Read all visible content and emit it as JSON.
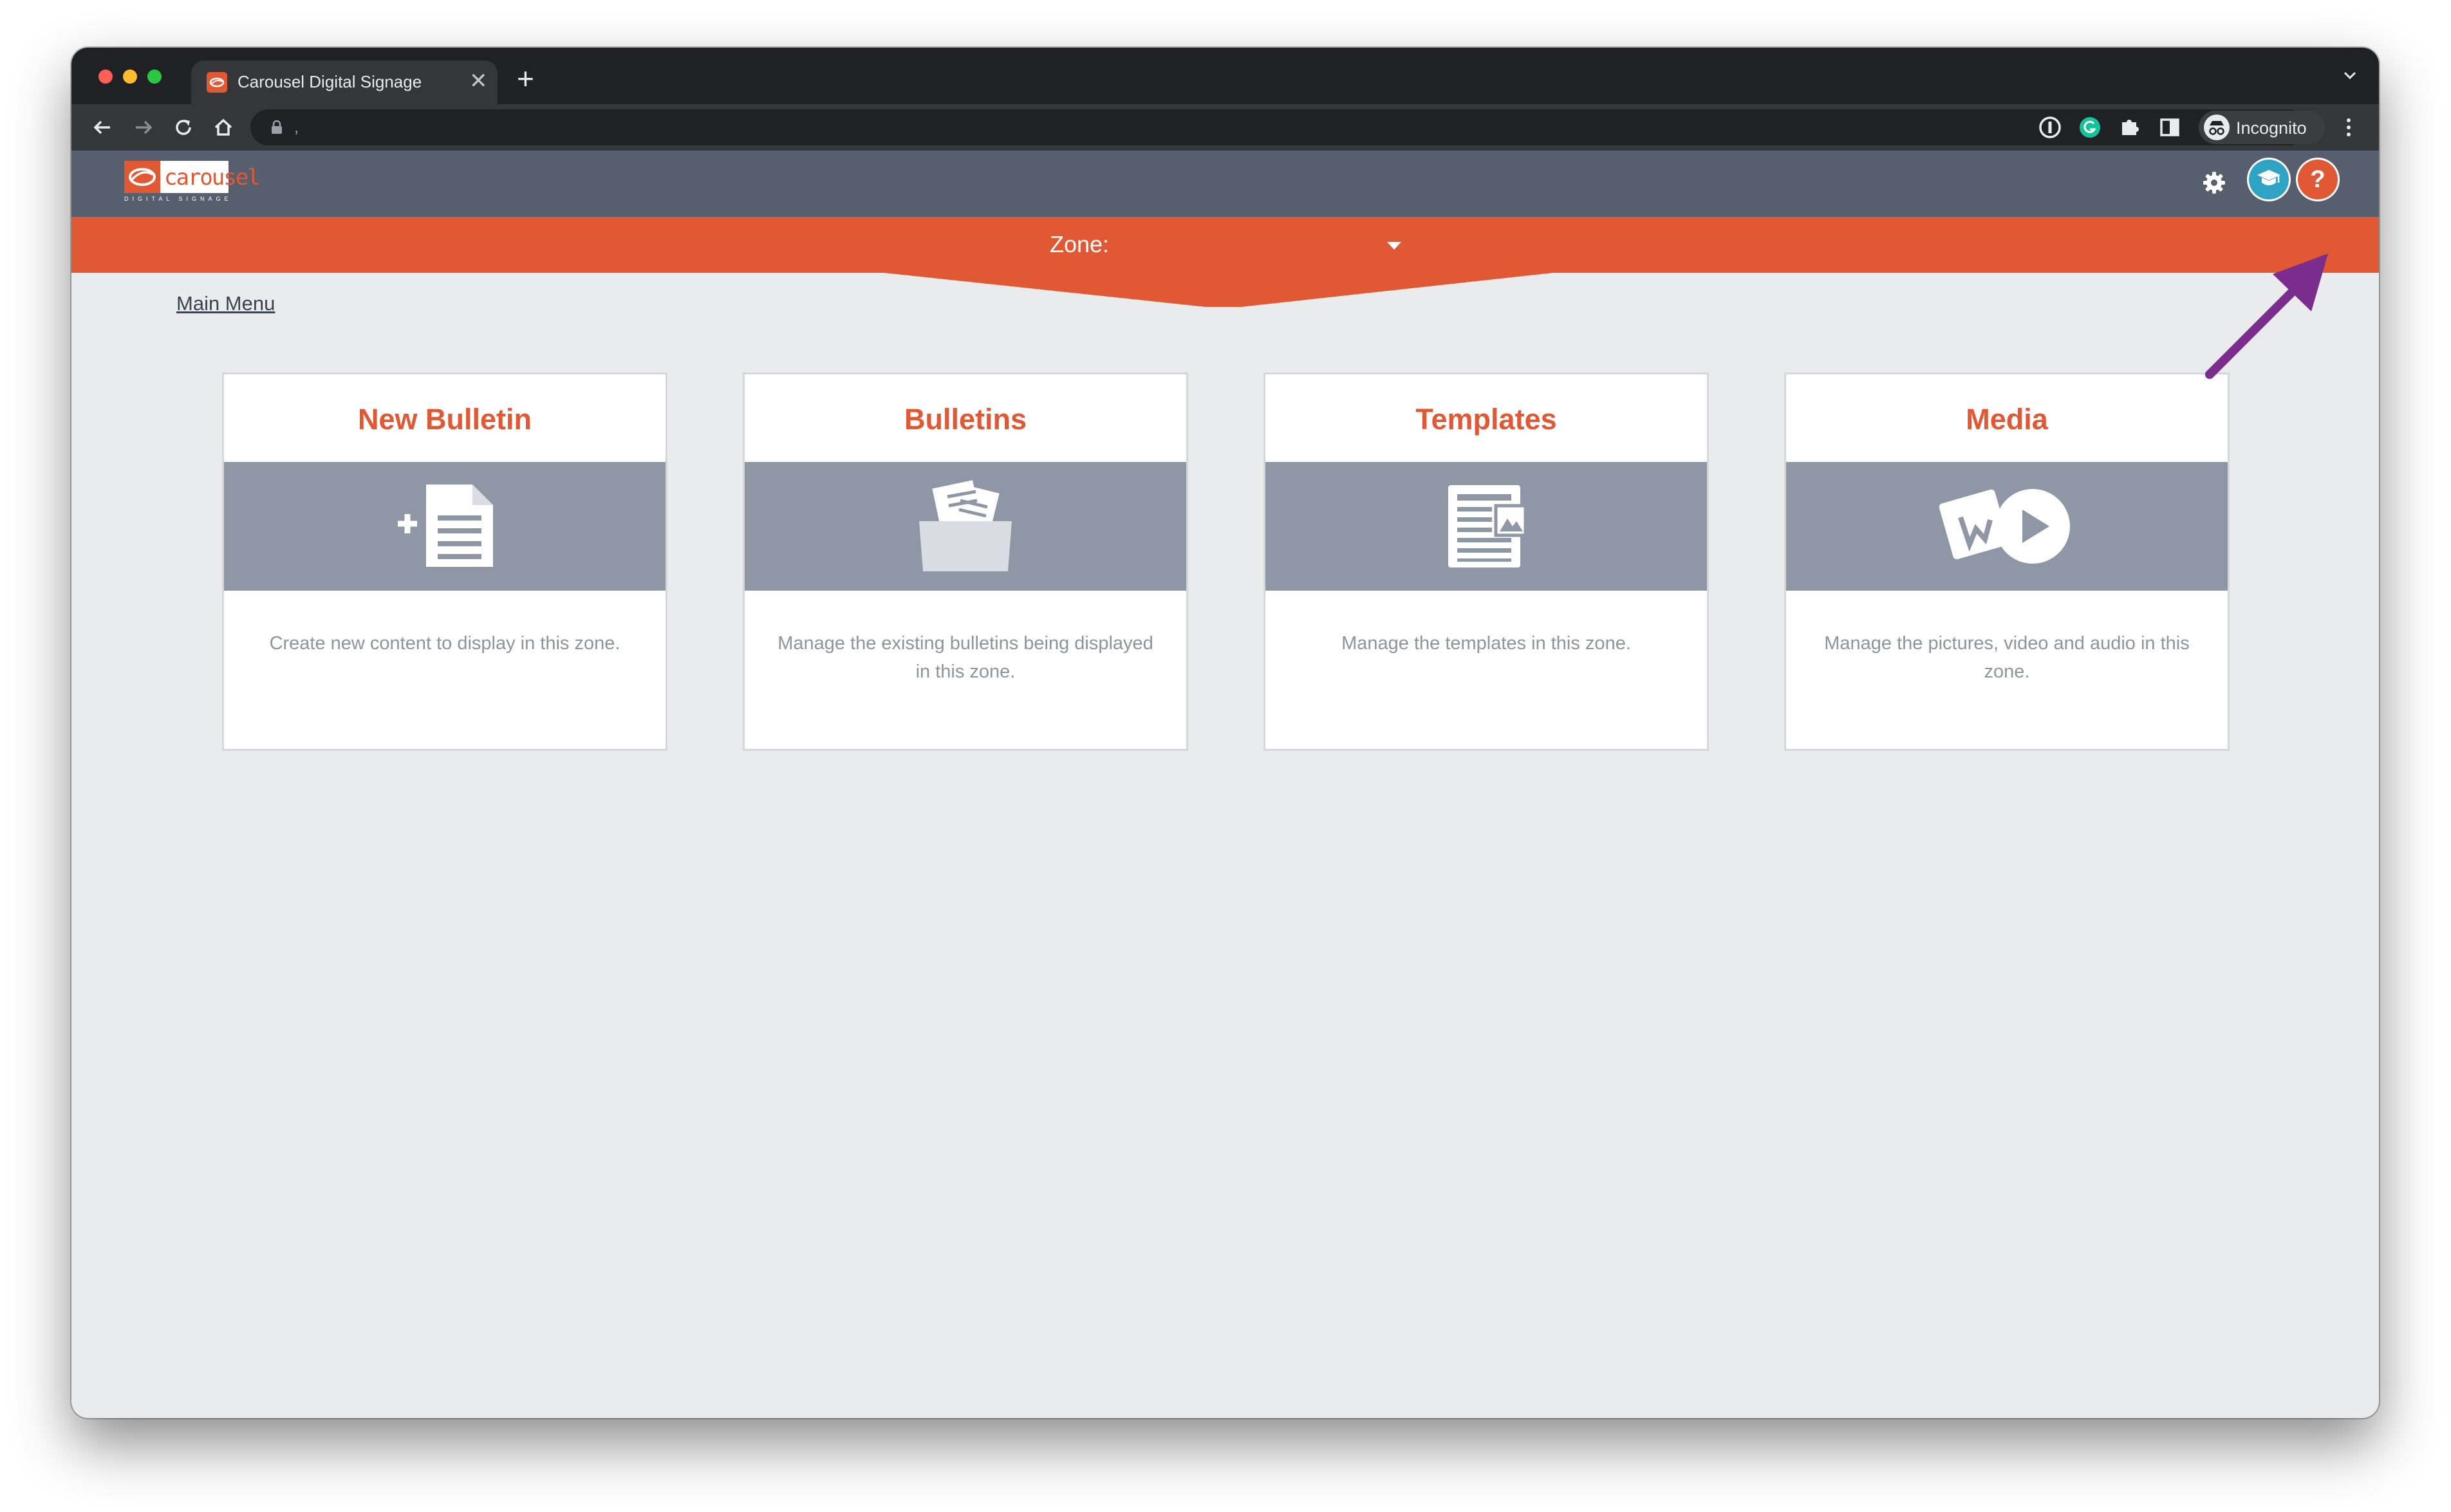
{
  "browser": {
    "tab_title": "Carousel Digital Signage",
    "tab_close": "✕",
    "new_tab": "+",
    "address": ",",
    "incognito_label": "Incognito"
  },
  "app": {
    "logo_text": "carousel",
    "logo_subtext": "DIGITAL SIGNAGE",
    "help_label": "?",
    "zone_label": "Zone:",
    "main_menu_link": "Main Menu"
  },
  "cards": [
    {
      "title": "New Bulletin",
      "icon": "new-document-icon",
      "description": "Create new content to display in this zone."
    },
    {
      "title": "Bulletins",
      "icon": "folder-documents-icon",
      "description": "Manage the existing bulletins being displayed in this zone."
    },
    {
      "title": "Templates",
      "icon": "template-icon",
      "description": "Manage the templates in this zone."
    },
    {
      "title": "Media",
      "icon": "media-play-icon",
      "description": "Manage the pictures, video and audio in this zone."
    }
  ],
  "colors": {
    "accent": "#e05934",
    "header": "#575f6e",
    "band": "#8f96a6",
    "learn_button": "#2fa3c4",
    "annotation_arrow": "#7b2d8e"
  }
}
